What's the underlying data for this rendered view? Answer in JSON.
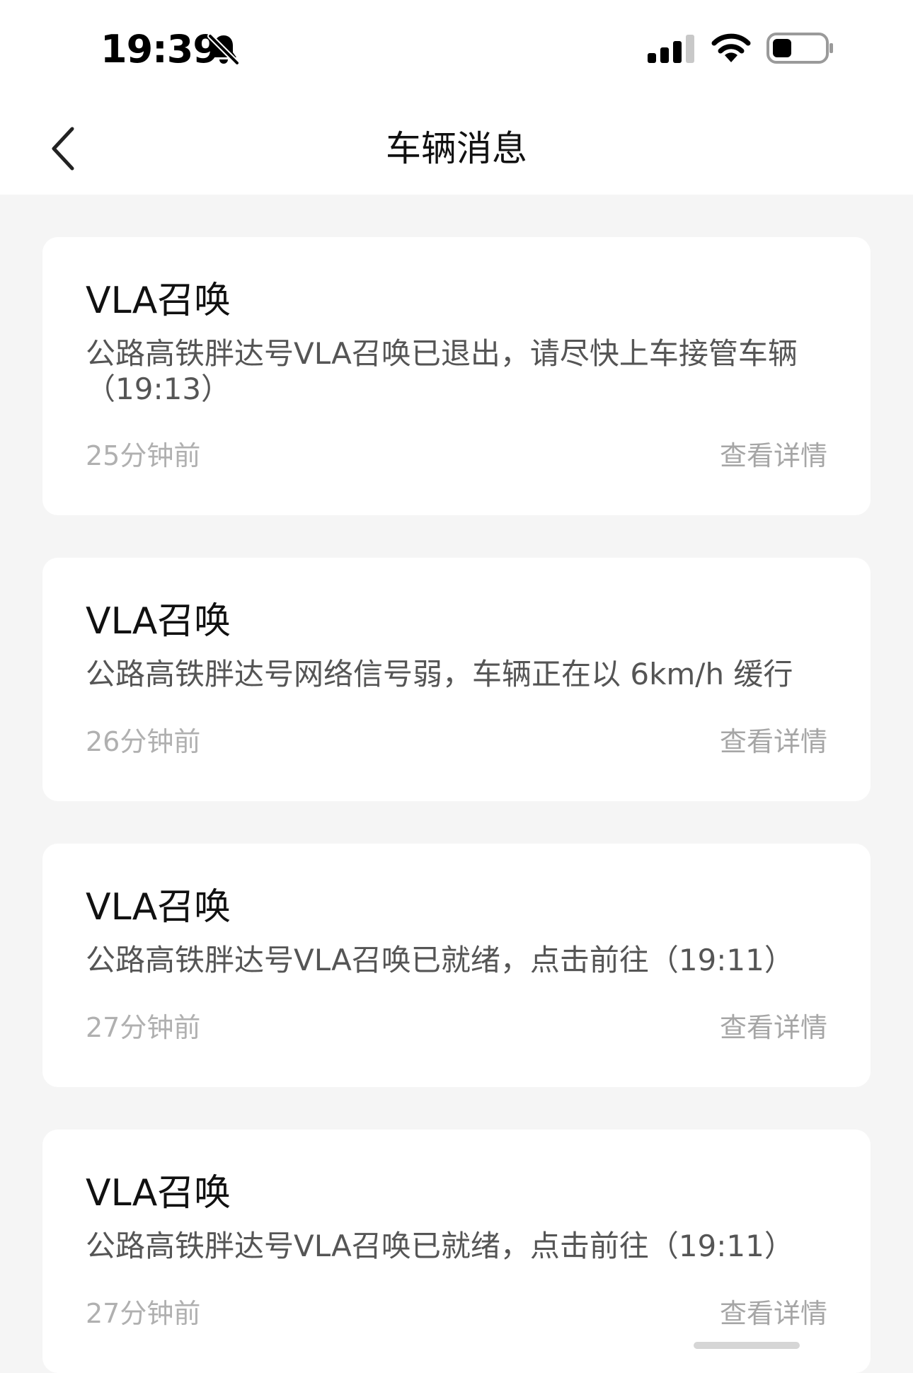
{
  "status_bar": {
    "time": "19:39"
  },
  "header": {
    "title": "车辆消息"
  },
  "messages": [
    {
      "title": "VLA召唤",
      "body": "公路高铁胖达号VLA召唤已退出，请尽快上车接管车辆（19:13）",
      "time": "25分钟前",
      "action": "查看详情"
    },
    {
      "title": "VLA召唤",
      "body": "公路高铁胖达号网络信号弱，车辆正在以 6km/h 缓行",
      "time": "26分钟前",
      "action": "查看详情"
    },
    {
      "title": "VLA召唤",
      "body": "公路高铁胖达号VLA召唤已就绪，点击前往（19:11）",
      "time": "27分钟前",
      "action": "查看详情"
    },
    {
      "title": "VLA召唤",
      "body": "公路高铁胖达号VLA召唤已就绪，点击前往（19:11）",
      "time": "27分钟前",
      "action": "查看详情"
    }
  ],
  "colors": {
    "background": "#f5f5f5",
    "card": "#ffffff",
    "title_text": "#111111",
    "body_text": "#555555",
    "meta_text": "#b0b0b0"
  },
  "icons": [
    "bell-slash-icon",
    "cellular-signal-icon",
    "wifi-icon",
    "battery-icon",
    "chevron-left-icon"
  ]
}
